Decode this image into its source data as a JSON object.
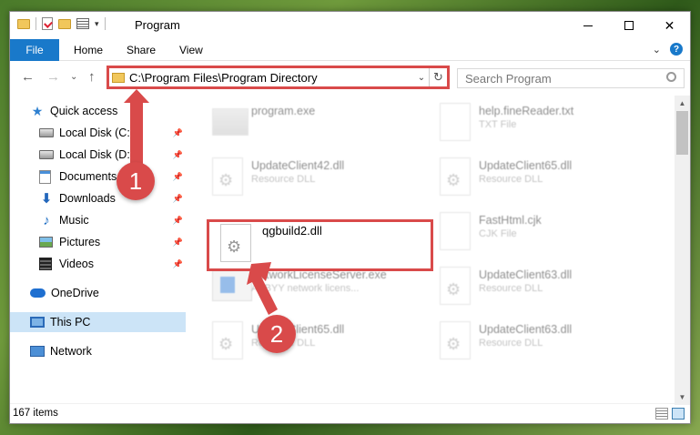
{
  "window": {
    "title": "Program"
  },
  "ribbon": {
    "tabs": [
      "File",
      "Home",
      "Share",
      "View"
    ],
    "help": "?"
  },
  "address": {
    "path": "C:\\Program Files\\Program Directory",
    "search_placeholder": "Search Program"
  },
  "nav": {
    "items": [
      {
        "label": "Quick access",
        "icon": "star-icon"
      },
      {
        "label": "Local Disk (C:)",
        "icon": "drive-icon",
        "pinned": true
      },
      {
        "label": "Local Disk (D:)",
        "icon": "drive-icon",
        "pinned": true
      },
      {
        "label": "Documents",
        "icon": "documents-icon",
        "pinned": true
      },
      {
        "label": "Downloads",
        "icon": "download-icon",
        "pinned": true
      },
      {
        "label": "Music",
        "icon": "music-icon",
        "pinned": true
      },
      {
        "label": "Pictures",
        "icon": "pictures-icon",
        "pinned": true
      },
      {
        "label": "Videos",
        "icon": "videos-icon",
        "pinned": true
      },
      {
        "label": "OneDrive",
        "icon": "cloud-icon"
      },
      {
        "label": "This PC",
        "icon": "computer-icon",
        "selected": true
      },
      {
        "label": "Network",
        "icon": "network-icon"
      }
    ]
  },
  "files": [
    {
      "name": "program.exe",
      "type": ""
    },
    {
      "name": "help.fineReader.txt",
      "type": "TXT File"
    },
    {
      "name": "UpdateClient42.dll",
      "type": "Resource DLL"
    },
    {
      "name": "UpdateClient65.dll",
      "type": "Resource DLL"
    },
    {
      "name": "qgbuild2.dll",
      "type": ""
    },
    {
      "name": "FastHtml.cjk",
      "type": "CJK File"
    },
    {
      "name": "NetworkLicenseServer.exe",
      "type": "ABBYY network licens..."
    },
    {
      "name": "UpdateClient63.dll",
      "type": "Resource DLL"
    },
    {
      "name": "UpdateClient65.dll",
      "type": "Resource DLL"
    },
    {
      "name": "UpdateClient63.dll",
      "type": "Resource DLL"
    }
  ],
  "status": {
    "items": "167 items"
  },
  "annotations": {
    "step1": "1",
    "step2": "2"
  },
  "colors": {
    "accent": "#1979ca",
    "highlight": "#d94a4a",
    "selected": "#cce4f7"
  }
}
